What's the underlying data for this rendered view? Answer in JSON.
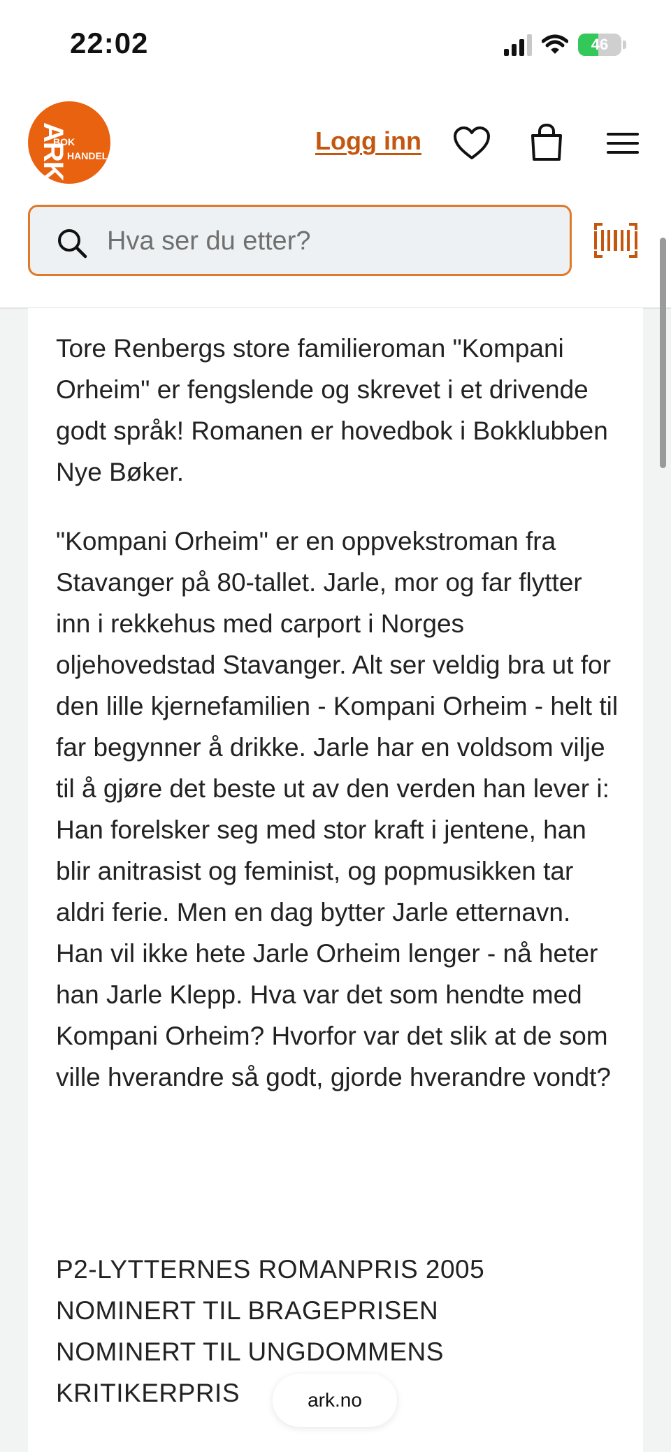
{
  "status_bar": {
    "time": "22:02",
    "battery_level": "46",
    "battery_percent": 46,
    "signal_bars_active": 3,
    "signal_bars_total": 4
  },
  "header": {
    "logo": {
      "line1": "ARK",
      "line2": "BOK",
      "line3": "HANDEL"
    },
    "login_label": "Logg inn",
    "icons": [
      "heart-icon",
      "shopping-bag-icon",
      "hamburger-menu-icon"
    ],
    "colors": {
      "brand": "#e8620f",
      "link": "#c4570f",
      "search_border": "#e07a2b"
    }
  },
  "search": {
    "placeholder": "Hva ser du etter?"
  },
  "description": {
    "intro": "Tore Renbergs store familieroman \"Kompani Orheim\" er fengslende og skrevet i et drivende godt språk! Romanen er hovedbok i Bokklubben Nye Bøker.",
    "body": "\"Kompani Orheim\" er en oppvekstroman fra Stavanger på 80-tallet. Jarle, mor og far flytter inn i rekkehus med carport i Norges oljehovedstad Stavanger. Alt ser veldig bra ut for den lille kjernefamilien - Kompani Orheim - helt til far begynner å drikke. Jarle har en voldsom vilje til å gjøre det beste ut av den verden han lever i: Han forelsker seg med stor kraft i jentene, han blir anitrasist og feminist, og popmusikken tar aldri ferie. Men en dag bytter Jarle etternavn. Han vil ikke hete Jarle Orheim lenger - nå heter han Jarle Klepp. Hva var det som hendte med Kompani Orheim? Hvorfor var det slik at de som ville hverandre så godt, gjorde hverandre vondt?",
    "awards": [
      "P2-LYTTERNES ROMANPRIS 2005",
      "NOMINERT TIL BRAGEPRISEN",
      "NOMINERT TIL UNGDOMMENS",
      "KRITIKERPRIS"
    ]
  },
  "browser": {
    "domain": "ark.no"
  }
}
